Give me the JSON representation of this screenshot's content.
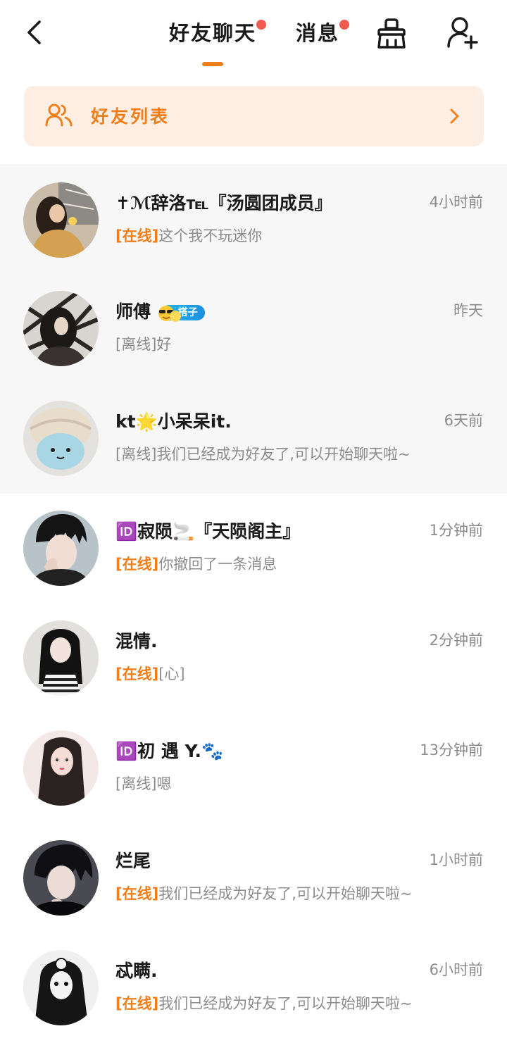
{
  "header": {
    "tabs": [
      {
        "label": "好友聊天",
        "active": true,
        "has_dot": true
      },
      {
        "label": "消息",
        "active": false,
        "has_dot": true
      }
    ],
    "icons": [
      "back-icon",
      "broom-icon",
      "add-user-icon"
    ]
  },
  "friend_list": {
    "label": "好友列表"
  },
  "accent_color": "#f07f1b",
  "dot_color": "#f05a4f",
  "conversations": [
    {
      "name": "✝ℳ辞洛℡『汤圆团成员』",
      "status": "[在线]",
      "online": true,
      "preview": "这个我不玩迷你",
      "time": "4小时前",
      "pinned": true
    },
    {
      "name": "师傅",
      "badge": "搭子",
      "status": "[离线]",
      "online": false,
      "preview": "好",
      "time": "昨天",
      "pinned": true
    },
    {
      "name": "kt🌟小呆呆it.",
      "status": "[离线]",
      "online": false,
      "preview": "我们已经成为好友了,可以开始聊天啦~",
      "time": "6天前",
      "pinned": true
    },
    {
      "name": "🆔寂陨🚬『天陨阁主』",
      "status": "[在线]",
      "online": true,
      "preview": "你撤回了一条消息",
      "time": "1分钟前",
      "pinned": false
    },
    {
      "name": "混情.",
      "status": "[在线]",
      "online": true,
      "preview": "[心]",
      "time": "2分钟前",
      "pinned": false
    },
    {
      "name": "🆔初 遇 Y.🐾",
      "status": "[离线]",
      "online": false,
      "preview": "嗯",
      "time": "13分钟前",
      "pinned": false
    },
    {
      "name": "烂尾",
      "status": "[在线]",
      "online": true,
      "preview": "我们已经成为好友了,可以开始聊天啦~",
      "time": "1小时前",
      "pinned": false
    },
    {
      "name": "忒瞒.",
      "status": "[在线]",
      "online": true,
      "preview": "我们已经成为好友了,可以开始聊天啦~",
      "time": "6小时前",
      "pinned": false
    }
  ]
}
